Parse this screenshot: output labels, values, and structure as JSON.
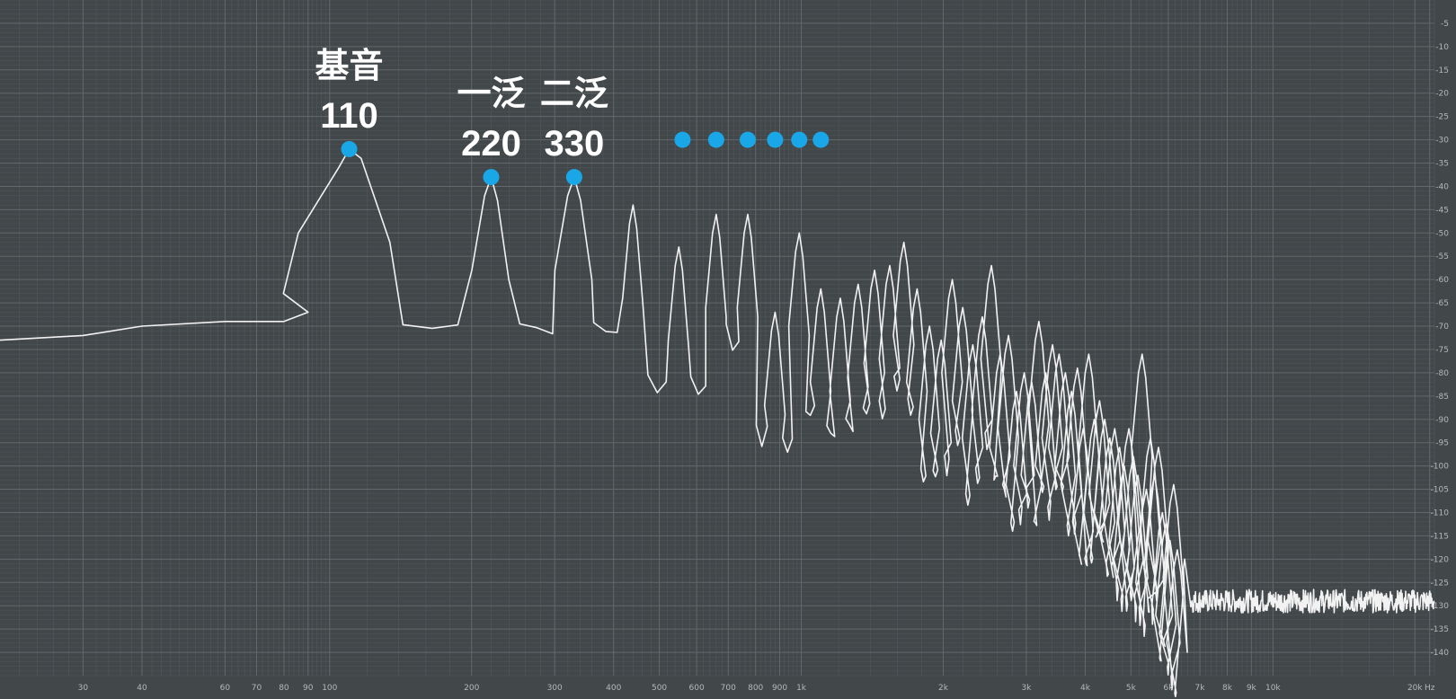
{
  "chart_data": {
    "type": "line",
    "xscale": "log",
    "xlim": [
      20,
      22000
    ],
    "ylim": [
      -145,
      0
    ],
    "grid": true,
    "x_ticks": [
      {
        "value": 30,
        "label": "30"
      },
      {
        "value": 40,
        "label": "40"
      },
      {
        "value": 60,
        "label": "60"
      },
      {
        "value": 70,
        "label": "70"
      },
      {
        "value": 80,
        "label": "80"
      },
      {
        "value": 90,
        "label": "90"
      },
      {
        "value": 100,
        "label": "100"
      },
      {
        "value": 200,
        "label": "200"
      },
      {
        "value": 300,
        "label": "300"
      },
      {
        "value": 400,
        "label": "400"
      },
      {
        "value": 500,
        "label": "500"
      },
      {
        "value": 600,
        "label": "600"
      },
      {
        "value": 700,
        "label": "700"
      },
      {
        "value": 800,
        "label": "800"
      },
      {
        "value": 900,
        "label": "900"
      },
      {
        "value": 1000,
        "label": "1k"
      },
      {
        "value": 2000,
        "label": "2k"
      },
      {
        "value": 3000,
        "label": "3k"
      },
      {
        "value": 4000,
        "label": "4k"
      },
      {
        "value": 5000,
        "label": "5k"
      },
      {
        "value": 6000,
        "label": "6k"
      },
      {
        "value": 7000,
        "label": "7k"
      },
      {
        "value": 8000,
        "label": "8k"
      },
      {
        "value": 9000,
        "label": "9k"
      },
      {
        "value": 10000,
        "label": "10k"
      },
      {
        "value": 20000,
        "label": "20k"
      },
      {
        "value": 21500,
        "label": "Hz"
      }
    ],
    "y_ticks": [
      {
        "value": -5,
        "label": "-5"
      },
      {
        "value": -10,
        "label": "-10"
      },
      {
        "value": -15,
        "label": "-15"
      },
      {
        "value": -20,
        "label": "-20"
      },
      {
        "value": -25,
        "label": "-25"
      },
      {
        "value": -30,
        "label": "-30"
      },
      {
        "value": -35,
        "label": "-35"
      },
      {
        "value": -40,
        "label": "-40"
      },
      {
        "value": -45,
        "label": "-45"
      },
      {
        "value": -50,
        "label": "-50"
      },
      {
        "value": -55,
        "label": "-55"
      },
      {
        "value": -60,
        "label": "-60"
      },
      {
        "value": -65,
        "label": "-65"
      },
      {
        "value": -70,
        "label": "-70"
      },
      {
        "value": -75,
        "label": "-75"
      },
      {
        "value": -80,
        "label": "-80"
      },
      {
        "value": -85,
        "label": "-85"
      },
      {
        "value": -90,
        "label": "-90"
      },
      {
        "value": -95,
        "label": "-95"
      },
      {
        "value": -100,
        "label": "-100"
      },
      {
        "value": -105,
        "label": "-105"
      },
      {
        "value": -110,
        "label": "-110"
      },
      {
        "value": -115,
        "label": "-115"
      },
      {
        "value": -120,
        "label": "-120"
      },
      {
        "value": -125,
        "label": "-125"
      },
      {
        "value": -130,
        "label": "-130"
      },
      {
        "value": -135,
        "label": "-135"
      },
      {
        "value": -140,
        "label": "-140"
      }
    ],
    "fundamental_hz": 110,
    "harmonic_peaks": [
      {
        "f": 110,
        "db": -32
      },
      {
        "f": 220,
        "db": -38
      },
      {
        "f": 330,
        "db": -38
      },
      {
        "f": 440,
        "db": -44
      },
      {
        "f": 550,
        "db": -53
      },
      {
        "f": 660,
        "db": -46
      },
      {
        "f": 770,
        "db": -46
      },
      {
        "f": 880,
        "db": -67
      },
      {
        "f": 990,
        "db": -50
      },
      {
        "f": 1100,
        "db": -62
      },
      {
        "f": 1210,
        "db": -64
      },
      {
        "f": 1320,
        "db": -61
      },
      {
        "f": 1430,
        "db": -58
      },
      {
        "f": 1540,
        "db": -57
      },
      {
        "f": 1650,
        "db": -52
      },
      {
        "f": 1760,
        "db": -62
      },
      {
        "f": 1870,
        "db": -70
      },
      {
        "f": 1980,
        "db": -73
      },
      {
        "f": 2090,
        "db": -60
      },
      {
        "f": 2200,
        "db": -66
      },
      {
        "f": 2310,
        "db": -74
      },
      {
        "f": 2420,
        "db": -68
      },
      {
        "f": 2530,
        "db": -57
      },
      {
        "f": 2640,
        "db": -76
      },
      {
        "f": 2750,
        "db": -72
      },
      {
        "f": 2860,
        "db": -84
      },
      {
        "f": 2970,
        "db": -80
      },
      {
        "f": 3080,
        "db": -82
      },
      {
        "f": 3190,
        "db": -69
      },
      {
        "f": 3300,
        "db": -80
      },
      {
        "f": 3410,
        "db": -74
      },
      {
        "f": 3520,
        "db": -76
      },
      {
        "f": 3630,
        "db": -80
      },
      {
        "f": 3740,
        "db": -84
      },
      {
        "f": 3850,
        "db": -79
      },
      {
        "f": 3960,
        "db": -92
      },
      {
        "f": 4070,
        "db": -76
      },
      {
        "f": 4180,
        "db": -90
      },
      {
        "f": 4290,
        "db": -86
      },
      {
        "f": 4400,
        "db": -90
      },
      {
        "f": 4510,
        "db": -94
      },
      {
        "f": 4620,
        "db": -92
      },
      {
        "f": 4730,
        "db": -96
      },
      {
        "f": 4840,
        "db": -100
      },
      {
        "f": 4950,
        "db": -92
      },
      {
        "f": 5060,
        "db": -98
      },
      {
        "f": 5170,
        "db": -102
      },
      {
        "f": 5280,
        "db": -76
      },
      {
        "f": 5390,
        "db": -105
      },
      {
        "f": 5500,
        "db": -94
      },
      {
        "f": 5610,
        "db": -102
      },
      {
        "f": 5720,
        "db": -96
      },
      {
        "f": 5830,
        "db": -110
      },
      {
        "f": 5940,
        "db": -112
      },
      {
        "f": 6050,
        "db": -116
      },
      {
        "f": 6160,
        "db": -104
      },
      {
        "f": 6270,
        "db": -118
      }
    ],
    "low_floor": [
      {
        "f": 20,
        "db": -73
      },
      {
        "f": 30,
        "db": -72
      },
      {
        "f": 40,
        "db": -70
      },
      {
        "f": 60,
        "db": -69
      },
      {
        "f": 80,
        "db": -69
      },
      {
        "f": 90,
        "db": -67
      }
    ],
    "noise_floor_db": -129,
    "noise_start_hz": 6700,
    "annotations": [
      {
        "line1": "基音",
        "line2": "110",
        "f": 110,
        "db": -32
      },
      {
        "line1": "一泛",
        "line2": "220",
        "f": 220,
        "db": -38
      },
      {
        "line1": "二泛",
        "line2": "330",
        "f": 330,
        "db": -38
      }
    ],
    "continuation_dots": {
      "f": [
        560,
        660,
        770,
        880,
        990,
        1100
      ],
      "db": -30
    },
    "colors": {
      "background": "#42474a",
      "grid_minor": "#555b5e",
      "grid_major": "#62686b",
      "curve": "#f2f2f2",
      "marker": "#1aa7e8",
      "annotation_text": "#ffffff",
      "tick_text": "#b4b8ba"
    }
  }
}
